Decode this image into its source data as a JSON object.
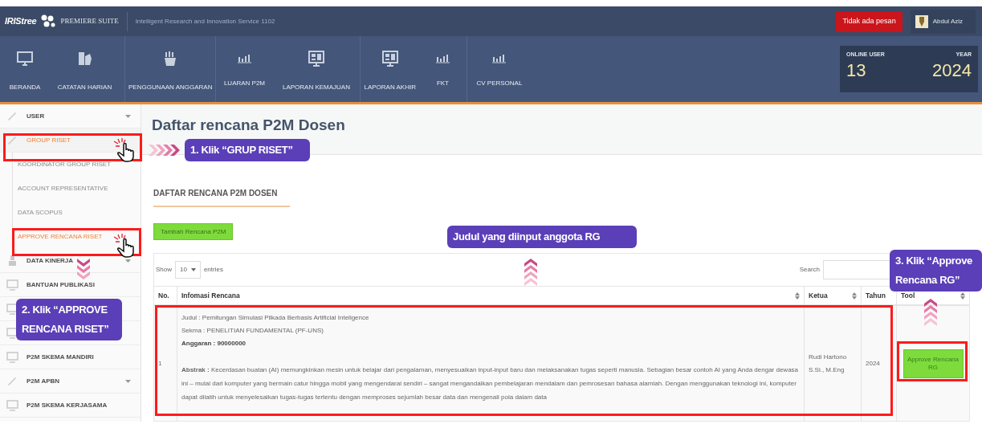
{
  "header": {
    "logo": "IRIStree",
    "suite": "PREMIERE SUITE",
    "tagline": "Intelligent Research and Innovation Service 1102",
    "messages_button": "Tidak ada pesan",
    "user": "Abdul Aziz"
  },
  "nav": [
    {
      "label": "BERANDA",
      "kind": "monitor"
    },
    {
      "label": "CATATAN HARIAN",
      "kind": "hand"
    },
    {
      "label": "PENGGUNAAN ANGGARAN",
      "kind": "cup"
    },
    {
      "label": "LUARAN P2M",
      "kind": "bars"
    },
    {
      "label": "LAPORAN KEMAJUAN",
      "kind": "screen"
    },
    {
      "label": "LAPORAN AKHIR",
      "kind": "screen"
    },
    {
      "label": "FKT",
      "kind": "bars"
    },
    {
      "label": "CV PERSONAL",
      "kind": "bars"
    }
  ],
  "stats": {
    "online_label": "ONLINE USER",
    "online": "13",
    "year_label": "YEAR",
    "year": "2024"
  },
  "sidebar": {
    "items": [
      {
        "label": "USER",
        "kind": "pencil",
        "selected": false,
        "caret": true
      },
      {
        "label": "GROUP RISET",
        "kind": "pencil",
        "selected": true,
        "caret": false,
        "children": [
          {
            "label": "KOORDINATOR GROUP RISET",
            "selected": false
          },
          {
            "label": "ACCOUNT REPRESENTATIVE",
            "selected": false
          },
          {
            "label": "DATA SCOPUS",
            "selected": false
          },
          {
            "label": "APPROVE RENCANA RISET",
            "selected": true
          }
        ]
      },
      {
        "label": "DATA KINERJA",
        "kind": "person",
        "selected": false,
        "caret": true
      },
      {
        "label": "BANTUAN PUBLIKASI",
        "kind": "screen",
        "selected": false,
        "caret": false
      },
      {
        "kind": "screen"
      },
      {
        "kind": "screen"
      },
      {
        "label": "P2M SKEMA MANDIRI",
        "kind": "screen",
        "selected": false,
        "caret": false
      },
      {
        "label": "P2M APBN",
        "kind": "pencil",
        "selected": false,
        "caret": true
      },
      {
        "label": "P2M SKEMA KERJASAMA",
        "kind": "screen",
        "selected": false,
        "caret": false
      }
    ]
  },
  "page": {
    "title": "Daftar rencana P2M Dosen",
    "panel_title": "DAFTAR RENCANA P2M DOSEN",
    "add_button": "Tambah Rencana P2M"
  },
  "table": {
    "show_label": "Show",
    "page_size": "10",
    "entries_label": "entries",
    "search_label": "Search",
    "columns": [
      {
        "label": "No.",
        "sortable": false
      },
      {
        "label": "Infomasi Rencana",
        "sortable": true
      },
      {
        "label": "Ketua",
        "sortable": true
      },
      {
        "label": "Tahun",
        "sortable": false
      },
      {
        "label": "Tool",
        "sortable": true
      }
    ],
    "rows": [
      {
        "no": "1",
        "info": [
          {
            "kind": "plain",
            "text": "Judul : Pemitungan Simulasi Pilkada Berbasis Artificial Inteligence"
          },
          {
            "kind": "plain",
            "text": "Sekma : PENELITIAN FUNDAMENTAL (PF-UNS)"
          },
          {
            "kind": "bold",
            "text": "Anggaran : 90000000"
          },
          {
            "kind": "plain",
            "text": "**Abstrak :** Kecerdasan buatan (AI) memungkinkan mesin untuk belajar dari pengalaman, menyesuaikan input-input baru dan melaksanakan tugas seperti manusia. Sebagian besar contoh AI yang Anda dengar dewasa ini – mulai dari komputer yang bermain catur hingga mobil yang mengendarai sendiri – sangat mengandalkan pembelajaran mendalam dan pemrosesan bahasa alamiah. Dengan menggunakan teknologi ini, komputer dapat dilatih untuk menyelesaikan tugas-tugas tertentu dengan memproses sejumlah besar data dan mengenali pola dalam data"
          }
        ],
        "ketua": "Rudi Hartono S.Si., M.Eng",
        "tahun": "2024",
        "action": "Approve Rencana RG"
      }
    ]
  },
  "annotations": [
    {
      "text": "1. Klik “GRUP RISET”"
    },
    {
      "text": "2. Klik “APPROVE RENCANA RISET”"
    },
    {
      "text": "Judul yang diinput anggota RG"
    },
    {
      "text": "3. Klik “Approve Rencana RG”"
    }
  ]
}
